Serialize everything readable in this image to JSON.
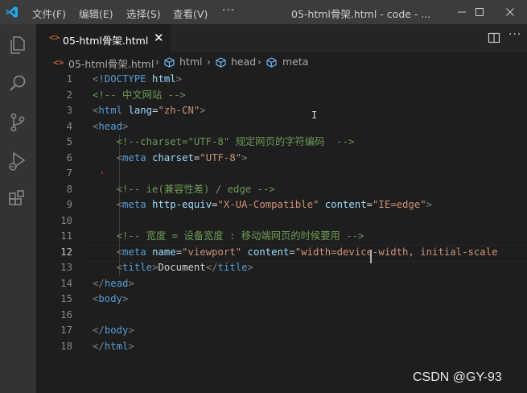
{
  "menu": {
    "file": "文件(F)",
    "edit": "编辑(E)",
    "select": "选择(S)",
    "view": "查看(V)",
    "more": "···"
  },
  "window": {
    "title": "05-html骨架.html - code - ..."
  },
  "tab": {
    "icon": "<>",
    "label": "05-html骨架.html",
    "close": "✕"
  },
  "toolbar": {
    "more": "···"
  },
  "breadcrumb": {
    "icon": "<>",
    "file": "05-html骨架.html",
    "sep": "›",
    "items": [
      "html",
      "head",
      "meta"
    ]
  },
  "editor": {
    "active_line": 12,
    "lines": [
      {
        "n": "1",
        "tokens": [
          {
            "c": "punct",
            "t": "<"
          },
          {
            "c": "tag",
            "t": "!DOCTYPE"
          },
          {
            "c": "text",
            "t": " "
          },
          {
            "c": "attr",
            "t": "html"
          },
          {
            "c": "punct",
            "t": ">"
          }
        ]
      },
      {
        "n": "2",
        "tokens": [
          {
            "c": "com",
            "t": "<!-- 中文网站 -->"
          }
        ]
      },
      {
        "n": "3",
        "tokens": [
          {
            "c": "punct",
            "t": "<"
          },
          {
            "c": "tag",
            "t": "html"
          },
          {
            "c": "text",
            "t": " "
          },
          {
            "c": "attr",
            "t": "lang"
          },
          {
            "c": "text",
            "t": "="
          },
          {
            "c": "str",
            "t": "\"zh-CN\""
          },
          {
            "c": "punct",
            "t": ">"
          }
        ]
      },
      {
        "n": "4",
        "tokens": [
          {
            "c": "punct",
            "t": "<"
          },
          {
            "c": "tag",
            "t": "head"
          },
          {
            "c": "punct",
            "t": ">"
          }
        ]
      },
      {
        "n": "5",
        "tokens": [
          {
            "c": "text",
            "t": "    "
          },
          {
            "c": "com",
            "t": "<!--charset=\"UTF-8\" 规定网页的字符编码  -->"
          }
        ]
      },
      {
        "n": "6",
        "tokens": [
          {
            "c": "text",
            "t": "    "
          },
          {
            "c": "punct",
            "t": "<"
          },
          {
            "c": "tag",
            "t": "meta"
          },
          {
            "c": "text",
            "t": " "
          },
          {
            "c": "attr",
            "t": "charset"
          },
          {
            "c": "text",
            "t": "="
          },
          {
            "c": "str",
            "t": "\"UTF-8\""
          },
          {
            "c": "punct",
            "t": ">"
          }
        ]
      },
      {
        "n": "7",
        "tokens": []
      },
      {
        "n": "8",
        "tokens": [
          {
            "c": "text",
            "t": "    "
          },
          {
            "c": "com",
            "t": "<!-- ie(兼容性差) / edge -->"
          }
        ]
      },
      {
        "n": "9",
        "tokens": [
          {
            "c": "text",
            "t": "    "
          },
          {
            "c": "punct",
            "t": "<"
          },
          {
            "c": "tag",
            "t": "meta"
          },
          {
            "c": "text",
            "t": " "
          },
          {
            "c": "attr",
            "t": "http-equiv"
          },
          {
            "c": "text",
            "t": "="
          },
          {
            "c": "str",
            "t": "\"X-UA-Compatible\""
          },
          {
            "c": "text",
            "t": " "
          },
          {
            "c": "attr",
            "t": "content"
          },
          {
            "c": "text",
            "t": "="
          },
          {
            "c": "str",
            "t": "\"IE=edge\""
          },
          {
            "c": "punct",
            "t": ">"
          }
        ]
      },
      {
        "n": "10",
        "tokens": []
      },
      {
        "n": "11",
        "tokens": [
          {
            "c": "text",
            "t": "    "
          },
          {
            "c": "com",
            "t": "<!-- 宽度 = 设备宽度 : 移动端网页的时候要用 -->"
          }
        ]
      },
      {
        "n": "12",
        "tokens": [
          {
            "c": "text",
            "t": "    "
          },
          {
            "c": "punct",
            "t": "<"
          },
          {
            "c": "tag",
            "t": "meta"
          },
          {
            "c": "text",
            "t": " "
          },
          {
            "c": "attr",
            "t": "name"
          },
          {
            "c": "text",
            "t": "="
          },
          {
            "c": "str",
            "t": "\"viewport\""
          },
          {
            "c": "text",
            "t": " "
          },
          {
            "c": "attr",
            "t": "content"
          },
          {
            "c": "text",
            "t": "="
          },
          {
            "c": "str",
            "t": "\"width=device-width, initial-scale"
          }
        ]
      },
      {
        "n": "13",
        "tokens": [
          {
            "c": "text",
            "t": "    "
          },
          {
            "c": "punct",
            "t": "<"
          },
          {
            "c": "tag",
            "t": "title"
          },
          {
            "c": "punct",
            "t": ">"
          },
          {
            "c": "text",
            "t": "Document"
          },
          {
            "c": "punct",
            "t": "</"
          },
          {
            "c": "tag",
            "t": "title"
          },
          {
            "c": "punct",
            "t": ">"
          }
        ]
      },
      {
        "n": "14",
        "tokens": [
          {
            "c": "punct",
            "t": "</"
          },
          {
            "c": "tag",
            "t": "head"
          },
          {
            "c": "punct",
            "t": ">"
          }
        ]
      },
      {
        "n": "15",
        "tokens": [
          {
            "c": "punct",
            "t": "<"
          },
          {
            "c": "tag",
            "t": "body"
          },
          {
            "c": "punct",
            "t": ">"
          }
        ]
      },
      {
        "n": "16",
        "tokens": []
      },
      {
        "n": "17",
        "tokens": [
          {
            "c": "punct",
            "t": "</"
          },
          {
            "c": "tag",
            "t": "body"
          },
          {
            "c": "punct",
            "t": ">"
          }
        ]
      },
      {
        "n": "18",
        "tokens": [
          {
            "c": "punct",
            "t": "</"
          },
          {
            "c": "tag",
            "t": "html"
          },
          {
            "c": "punct",
            "t": ">"
          }
        ]
      }
    ]
  },
  "watermark": "CSDN @GY-93",
  "colors": {
    "titlebar": "#3c3c3c",
    "activitybar": "#333333",
    "editor_bg": "#1e1e1e",
    "tag": "#569cd6",
    "attr": "#9cdcfe",
    "string": "#ce9178",
    "comment": "#6a9955",
    "html_icon": "#e37933",
    "vscode_blue": "#23a9f2"
  },
  "icons": {
    "logo": "vscode-logo-icon",
    "activity": [
      "explorer-icon",
      "search-icon",
      "source-control-icon",
      "run-debug-icon",
      "extensions-icon"
    ],
    "window": [
      "minimize-icon",
      "maximize-icon",
      "close-icon"
    ],
    "editor_actions": [
      "split-editor-icon",
      "more-actions-icon"
    ],
    "breadcrumb": "cube-icon"
  }
}
